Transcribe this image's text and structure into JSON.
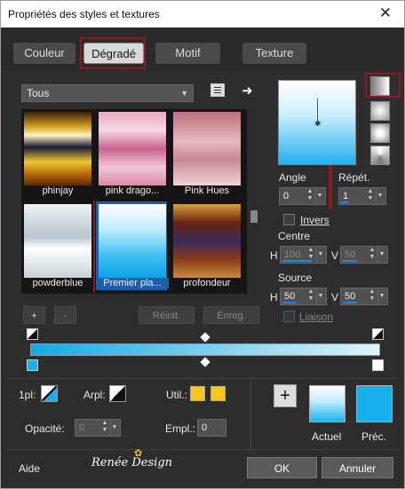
{
  "window": {
    "title": "Propriétés des styles et textures",
    "close": "✕"
  },
  "tabs": [
    {
      "label": "Couleur"
    },
    {
      "label": "Dégradé"
    },
    {
      "label": "Motif"
    },
    {
      "label": "Texture"
    }
  ],
  "filter": {
    "value": "Tous"
  },
  "gradients": [
    {
      "label": "phinjay"
    },
    {
      "label": "pink drago..."
    },
    {
      "label": "Pink Hues"
    },
    {
      "label": "powderblue"
    },
    {
      "label": "Premier pla..."
    },
    {
      "label": "profondeur"
    }
  ],
  "buttons": {
    "add": "+",
    "remove": "-",
    "reset": "Réinit.",
    "save": "Enreg.",
    "ok": "OK",
    "cancel": "Annuler",
    "help": "Aide"
  },
  "angle": {
    "label": "Angle",
    "value": "0"
  },
  "repeat": {
    "label": "Répét.",
    "value": "1"
  },
  "invert": {
    "label": "Invers"
  },
  "center": {
    "label": "Centre",
    "h_label": "H",
    "h": "100",
    "v_label": "V",
    "v": "50"
  },
  "source": {
    "label": "Source",
    "h_label": "H",
    "h": "50",
    "v_label": "V",
    "v": "50"
  },
  "link": {
    "label": "Liaison"
  },
  "lower": {
    "ipl": "1pl:",
    "arpl": "Arpl:",
    "util": "Util.:",
    "opacity_label": "Opacité:",
    "opacity": "0",
    "empl_label": "Empl.:",
    "empl": "0"
  },
  "current": {
    "label": "Actuel"
  },
  "previous": {
    "label": "Préc."
  },
  "watermark": "Renée Design",
  "colors": {
    "accent": "#1e88e5",
    "highlight_border": "#8b1b1b",
    "gradient_start": "#13a9e6",
    "gradient_end": "#dff4fd",
    "swatch_prev": "#1ab0ee",
    "util_color": "#f3c623"
  }
}
